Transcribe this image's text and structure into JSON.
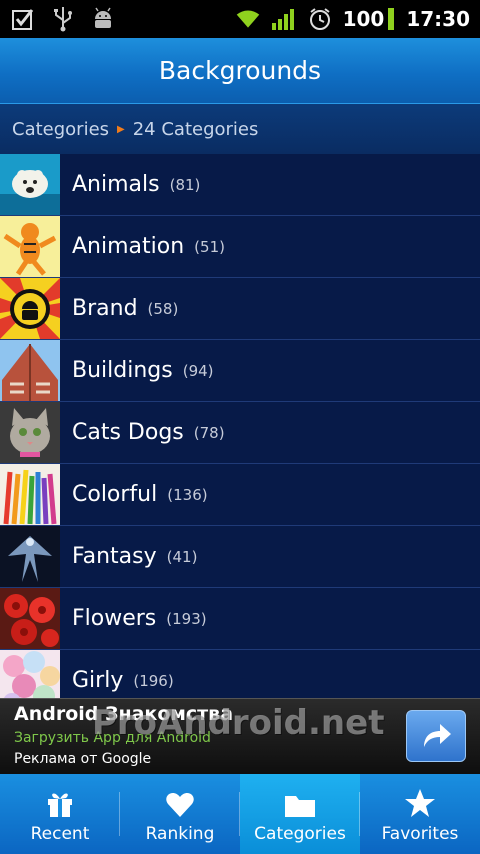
{
  "status_bar": {
    "icons_left": [
      "checkbox-icon",
      "usb-icon",
      "android-debug-icon"
    ],
    "icons_right": [
      "wifi-icon",
      "signal-icon",
      "alarm-icon"
    ],
    "battery": "100",
    "time": "17:30"
  },
  "header": {
    "title": "Backgrounds"
  },
  "breadcrumb": {
    "root": "Categories",
    "current": "24 Categories"
  },
  "categories": [
    {
      "label": "Animals",
      "count": "(81)"
    },
    {
      "label": "Animation",
      "count": "(51)"
    },
    {
      "label": "Brand",
      "count": "(58)"
    },
    {
      "label": "Buildings",
      "count": "(94)"
    },
    {
      "label": "Cats Dogs",
      "count": "(78)"
    },
    {
      "label": "Colorful",
      "count": "(136)"
    },
    {
      "label": "Fantasy",
      "count": "(41)"
    },
    {
      "label": "Flowers",
      "count": "(193)"
    },
    {
      "label": "Girly",
      "count": "(196)"
    }
  ],
  "ad": {
    "title": "Android Знакомства",
    "subtitle": "Загрузить App для Android",
    "source": "Реклама от Google",
    "watermark": "ProAndroid.net"
  },
  "tabs": [
    {
      "label": "Recent",
      "icon": "gift-icon"
    },
    {
      "label": "Ranking",
      "icon": "heart-icon"
    },
    {
      "label": "Categories",
      "icon": "folder-icon",
      "active": true
    },
    {
      "label": "Favorites",
      "icon": "star-icon"
    }
  ],
  "colors": {
    "accent": "#1a8fe0",
    "list_bg": "#071a48",
    "breadcrumb_sep": "#f07c1c",
    "ad_subtitle": "#7fc84a"
  }
}
